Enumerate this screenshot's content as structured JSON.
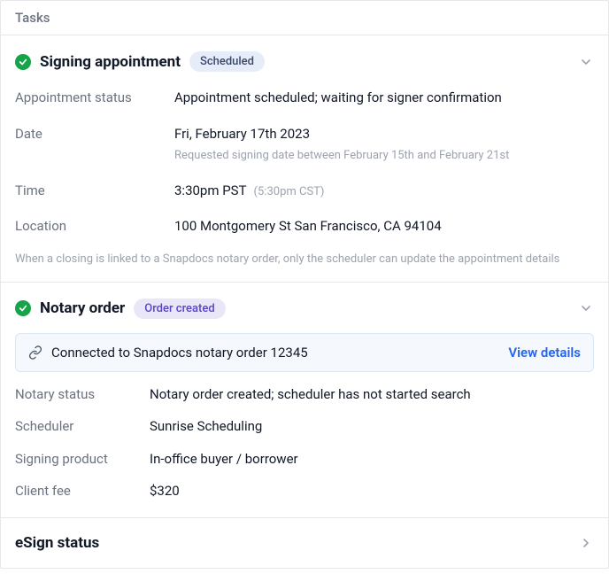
{
  "panel_title": "Tasks",
  "signing": {
    "title": "Signing appointment",
    "badge": "Scheduled",
    "status_label": "Appointment status",
    "status_value": "Appointment scheduled; waiting for signer confirmation",
    "date_label": "Date",
    "date_value": "Fri, February 17th 2023",
    "date_sub": "Requested signing date between February 15th and February 21st",
    "time_label": "Time",
    "time_value": "3:30pm PST",
    "time_alt": "(5:30pm CST)",
    "location_label": "Location",
    "location_value": "100 Montgomery St San Francisco, CA 94104",
    "footnote": "When a closing is linked to a Snapdocs notary order, only the scheduler can update the appointment details"
  },
  "notary": {
    "title": "Notary order",
    "badge": "Order created",
    "connected_msg": "Connected to Snapdocs notary order 12345",
    "view_details": "View details",
    "status_label": "Notary status",
    "status_value": "Notary order created; scheduler has not started search",
    "scheduler_label": "Scheduler",
    "scheduler_value": "Sunrise Scheduling",
    "product_label": "Signing product",
    "product_value": "In-office buyer / borrower",
    "fee_label": "Client fee",
    "fee_value": "$320"
  },
  "esign": {
    "title": "eSign status"
  }
}
